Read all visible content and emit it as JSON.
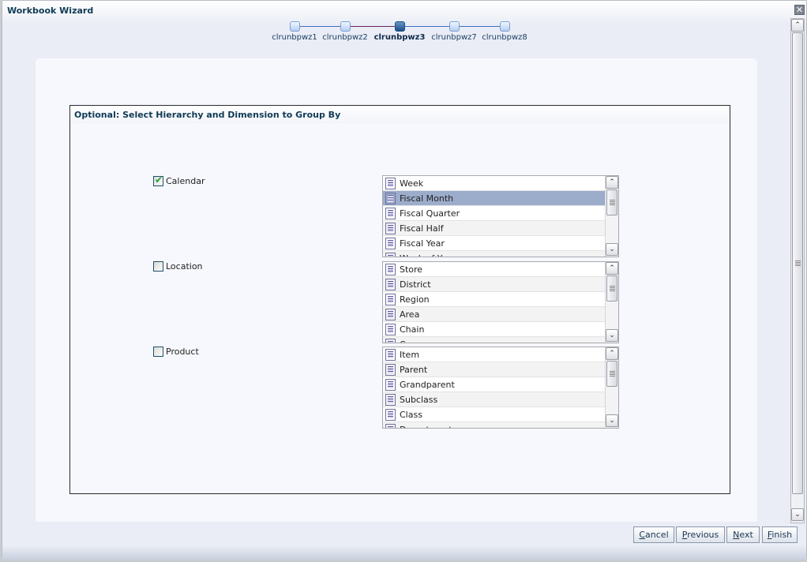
{
  "dialog": {
    "title": "Workbook Wizard",
    "close_icon": "close-icon"
  },
  "train": {
    "steps": [
      {
        "label": "clrunbpwz1",
        "state": "visited"
      },
      {
        "label": "clrunbpwz2",
        "state": "visited"
      },
      {
        "label": "clrunbpwz3",
        "state": "current"
      },
      {
        "label": "clrunbpwz7",
        "state": "unvisited"
      },
      {
        "label": "clrunbpwz8",
        "state": "unvisited"
      }
    ]
  },
  "group": {
    "title": "Optional: Select Hierarchy and Dimension to Group By",
    "hierarchies": [
      {
        "label": "Calendar",
        "checked": true,
        "items": [
          "Week",
          "Fiscal Month",
          "Fiscal Quarter",
          "Fiscal Half",
          "Fiscal Year",
          "Week of Year"
        ],
        "selected": "Fiscal Month"
      },
      {
        "label": "Location",
        "checked": false,
        "items": [
          "Store",
          "District",
          "Region",
          "Area",
          "Chain",
          "Company"
        ],
        "selected": null
      },
      {
        "label": "Product",
        "checked": false,
        "items": [
          "Item",
          "Parent",
          "Grandparent",
          "Subclass",
          "Class",
          "Department"
        ],
        "selected": null
      }
    ]
  },
  "buttons": {
    "cancel": {
      "mnemonic": "C",
      "rest": "ancel"
    },
    "previous": {
      "mnemonic": "P",
      "rest": "revious"
    },
    "next": {
      "mnemonic": "N",
      "rest": "ext"
    },
    "finish": {
      "mnemonic": "F",
      "rest": "inish"
    }
  },
  "colors": {
    "title_text": "#0f3a55",
    "selected_row": "#9caccb",
    "checkmark": "#22a22d"
  }
}
